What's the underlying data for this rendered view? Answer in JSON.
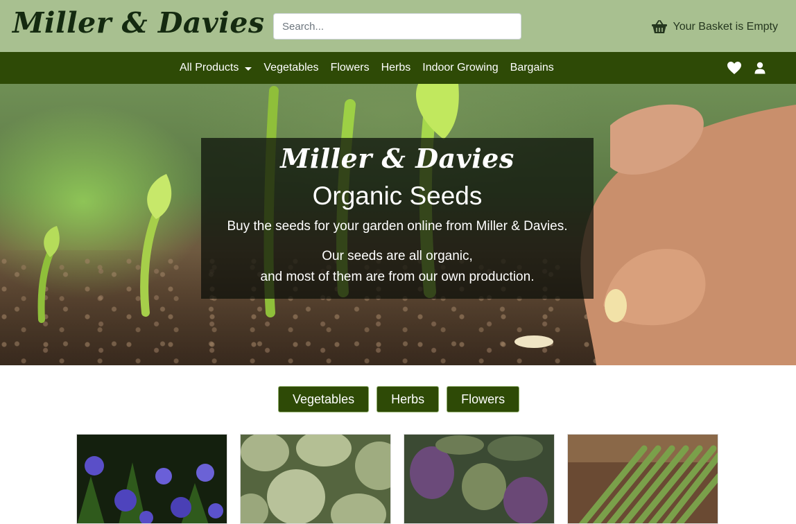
{
  "header": {
    "logo": "Miller & Davies",
    "search_placeholder": "Search...",
    "basket_label": "Your Basket is Empty",
    "basket_icon": "basket-icon"
  },
  "nav": {
    "items": [
      {
        "label": "All Products",
        "has_dropdown": true
      },
      {
        "label": "Vegetables"
      },
      {
        "label": "Flowers"
      },
      {
        "label": "Herbs"
      },
      {
        "label": "Indoor Growing"
      },
      {
        "label": "Bargains"
      }
    ],
    "icons": [
      "heart-icon",
      "user-icon"
    ]
  },
  "hero": {
    "brand": "Miller & Davies",
    "title": "Organic Seeds",
    "line1": "Buy the seeds for your garden online from Miller & Davies.",
    "line2": "Our seeds are all organic,",
    "line3": "and most of them are from our own production."
  },
  "categories": [
    {
      "label": "Vegetables"
    },
    {
      "label": "Herbs"
    },
    {
      "label": "Flowers"
    }
  ],
  "products": [
    {
      "image": "purple columbine flowers"
    },
    {
      "image": "green artichokes"
    },
    {
      "image": "purple artichokes"
    },
    {
      "image": "green asparagus"
    }
  ],
  "colors": {
    "header_bg": "#a8c090",
    "nav_bg": "#2e4a06",
    "button_bg": "#2e4a06",
    "logo_text": "#142a10"
  }
}
